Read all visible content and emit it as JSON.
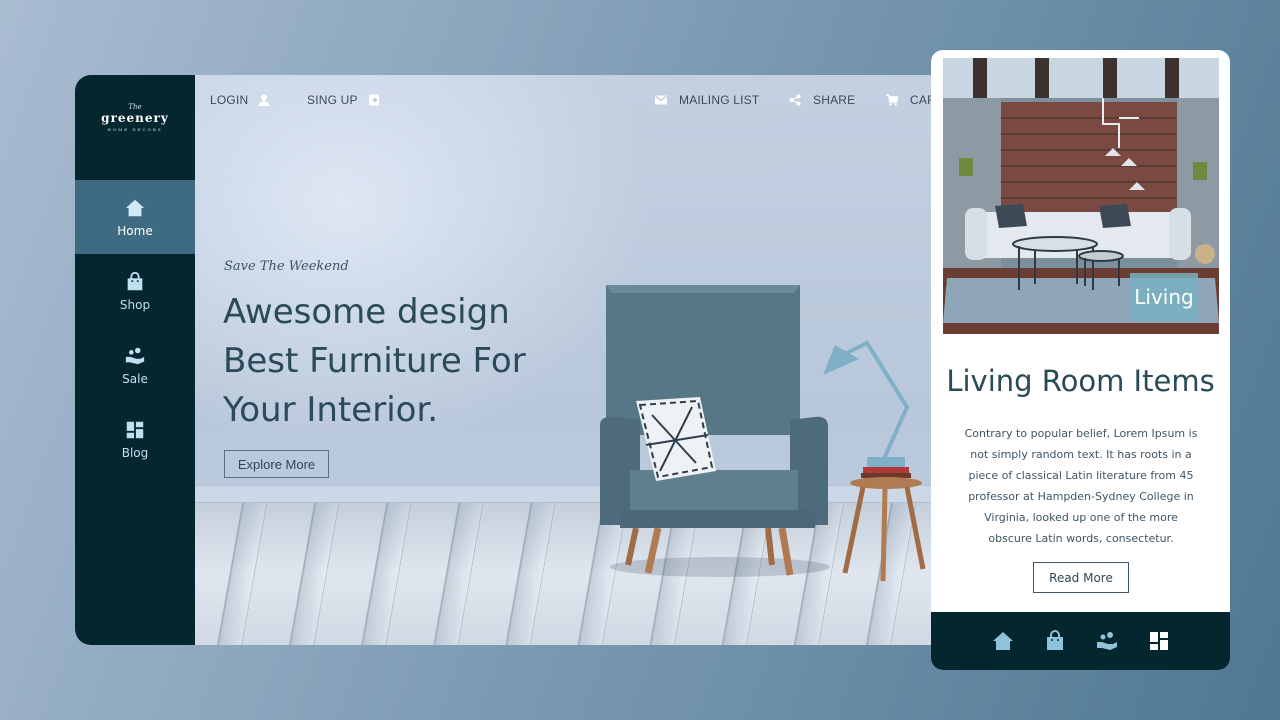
{
  "logo": {
    "small": "The",
    "name": "greenery",
    "tagline": "HOME DECORS"
  },
  "sidebar": {
    "items": [
      {
        "label": "Home",
        "icon": "home-icon",
        "active": true
      },
      {
        "label": "Shop",
        "icon": "shopping-bag-icon",
        "active": false
      },
      {
        "label": "Sale",
        "icon": "hand-coins-icon",
        "active": false
      },
      {
        "label": "Blog",
        "icon": "dashboard-icon",
        "active": false
      }
    ]
  },
  "topbar": {
    "login": "LOGIN",
    "signup": "SING UP",
    "mailing": "MAILING LIST",
    "share": "SHARE",
    "cart": "CART"
  },
  "hero": {
    "tagline": "Save The Weekend",
    "headline": [
      "Awesome design",
      "Best Furniture For",
      "Your Interior."
    ],
    "button": "Explore More"
  },
  "card": {
    "badge": "Living",
    "title": "Living Room Items",
    "body": "Contrary to popular belief, Lorem Ipsum is not simply random text. It has roots in a piece of classical Latin literature from 45 professor at Hampden-Sydney College in Virginia, looked up one of the more obscure Latin words, consectetur.",
    "button": "Read More"
  },
  "colors": {
    "sidebar": "#03262f",
    "active": "#3f6b82",
    "text_dark": "#2a4a57",
    "icon_light": "#bfe0f0",
    "icon_mobile": "#8fc3db"
  }
}
